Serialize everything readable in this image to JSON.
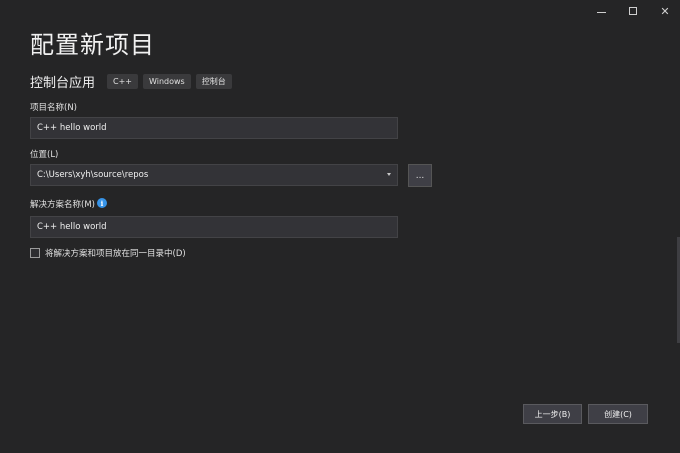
{
  "window": {
    "minimize_icon": "minimize-icon",
    "maximize_icon": "maximize-icon",
    "close_glyph": "✕"
  },
  "page": {
    "title": "配置新项目",
    "subtitle": "控制台应用",
    "tags": [
      "C++",
      "Windows",
      "控制台"
    ]
  },
  "form": {
    "project_name_label": "项目名称(N)",
    "project_name_value": "C++ hello world",
    "location_label": "位置(L)",
    "location_value": "C:\\Users\\xyh\\source\\repos",
    "browse_label": "...",
    "solution_name_label": "解决方案名称(M)",
    "solution_info_glyph": "i",
    "solution_name_value": "C++ hello world",
    "same_dir_label": "将解决方案和项目放在同一目录中(D)",
    "same_dir_checked": false
  },
  "footer": {
    "back_label": "上一步(B)",
    "create_label": "创建(C)"
  },
  "colors": {
    "background": "#252526",
    "input_bg": "#333337",
    "info_accent": "#3794e8"
  }
}
